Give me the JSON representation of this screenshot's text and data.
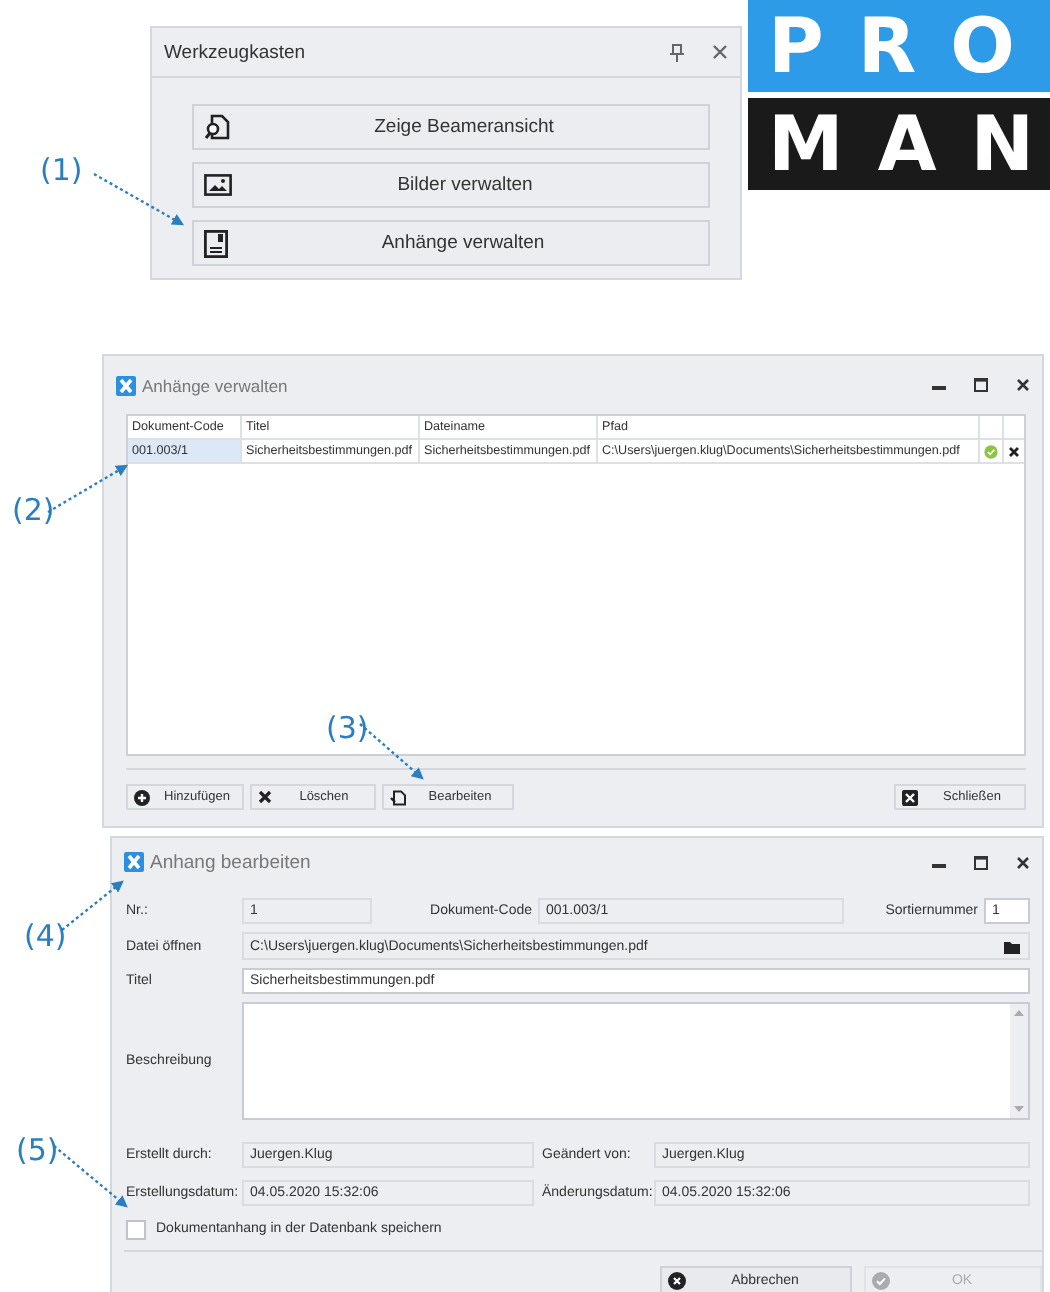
{
  "toolbox": {
    "title": "Werkzeugkasten",
    "buttons": [
      {
        "label": "Zeige Beameransicht",
        "kind": "beamer"
      },
      {
        "label": "Bilder verwalten",
        "kind": "images"
      },
      {
        "label": "Anhänge verwalten",
        "kind": "attachments"
      }
    ]
  },
  "logo": {
    "lines": [
      "PRO",
      "MAN"
    ]
  },
  "annotations": [
    {
      "label": "(1)"
    },
    {
      "label": "(2)"
    },
    {
      "label": "(3)"
    },
    {
      "label": "(4)"
    },
    {
      "label": "(5)"
    }
  ],
  "attachments_window": {
    "title": "Anhänge verwalten",
    "columns": [
      "Dokument-Code",
      "Titel",
      "Dateiname",
      "Pfad"
    ],
    "rows": [
      {
        "cells": [
          "001.003/1",
          "Sicherheitsbestimmungen.pdf",
          "Sicherheitsbestimmungen.pdf",
          "C:\\Users\\juergen.klug\\Documents\\Sicherheitsbestimmungen.pdf"
        ],
        "selected": true
      }
    ],
    "buttons": [
      {
        "label": "Hinzufügen",
        "kind": "add"
      },
      {
        "label": "Löschen",
        "kind": "delete"
      },
      {
        "label": "Bearbeiten",
        "kind": "edit"
      }
    ],
    "close_button": {
      "label": "Schließen"
    }
  },
  "edit_window": {
    "title": "Anhang bearbeiten",
    "nr": {
      "label": "Nr.:",
      "value": "1",
      "readonly": true
    },
    "document_code": {
      "label": "Dokument-Code",
      "value": "001.003/1",
      "readonly": true
    },
    "sort_number": {
      "label": "Sortiernummer",
      "value": "1",
      "readonly": false
    },
    "file": {
      "label": "Datei öffnen",
      "value": "C:\\Users\\juergen.klug\\Documents\\Sicherheitsbestimmungen.pdf",
      "readonly": true
    },
    "title_field": {
      "label": "Titel",
      "value": "Sicherheitsbestimmungen.pdf",
      "readonly": false
    },
    "description": {
      "label": "Beschreibung",
      "readonly": false
    },
    "created_by": {
      "label": "Erstellt durch:",
      "value": "Juergen.Klug",
      "readonly": true
    },
    "changed_by": {
      "label": "Geändert von:",
      "value": "Juergen.Klug",
      "readonly": true
    },
    "created_at": {
      "label": "Erstellungsdatum:",
      "value": "04.05.2020 15:32:06",
      "readonly": true
    },
    "changed_at": {
      "label": "Änderungsdatum:",
      "value": "04.05.2020 15:32:06",
      "readonly": true
    },
    "store_in_db": {
      "label": "Dokumentanhang in der Datenbank speichern",
      "checked": false
    },
    "cancel_button": {
      "label": "Abbrechen"
    },
    "ok_button": {
      "label": "OK",
      "disabled": true
    }
  }
}
